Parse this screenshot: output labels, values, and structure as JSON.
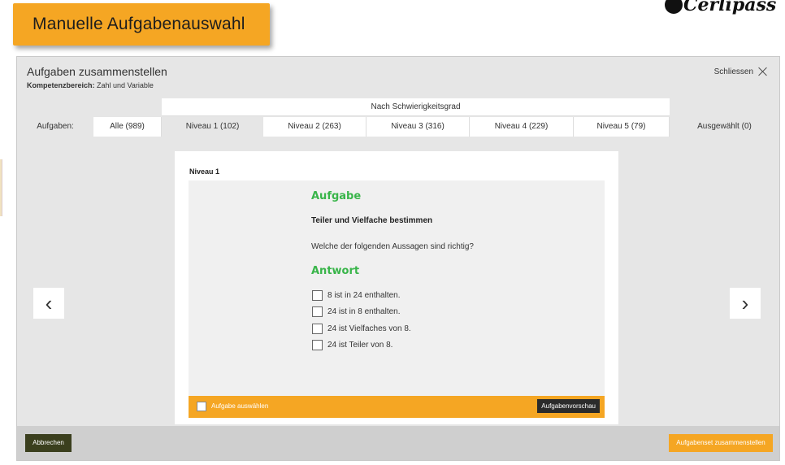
{
  "banner": {
    "title": "Manuelle Aufgabenauswahl"
  },
  "logo": {
    "text": "Cerlipass"
  },
  "window": {
    "title": "Aufgaben zusammenstellen",
    "subtitle_label": "Kompetenzbereich:",
    "subtitle_value": "Zahl und Variable",
    "close_label": "Schliessen"
  },
  "filter": {
    "difficulty_header": "Nach Schwierigkeitsgrad",
    "label": "Aufgaben:",
    "tabs": [
      "Alle (989)",
      "Niveau 1 (102)",
      "Niveau 2 (263)",
      "Niveau 3 (316)",
      "Niveau 4 (229)",
      "Niveau 5 (79)"
    ],
    "selected_tab": "Ausgewählt (0)"
  },
  "navigation": {
    "prev_icon": "‹",
    "next_icon": "›"
  },
  "card": {
    "level": "Niveau 1",
    "task_heading": "Aufgabe",
    "task_title": "Teiler und Vielfache bestimmen",
    "question": "Welche der folgenden Aussagen sind richtig?",
    "answer_heading": "Antwort",
    "options": [
      "8 ist in 24 enthalten.",
      "24 ist in 8 enthalten.",
      "24 ist Vielfaches von 8.",
      "24 ist Teiler von 8."
    ],
    "select_label": "Aufgabe auswählen",
    "preview_button": "Aufgabenvorschau"
  },
  "footer": {
    "cancel_button": "Abbrechen",
    "build_button": "Aufgabenset zusammenstellen"
  },
  "colors": {
    "accent": "#f5a623",
    "heading_green": "#39b54a",
    "dark_button": "#3b3f1e"
  }
}
